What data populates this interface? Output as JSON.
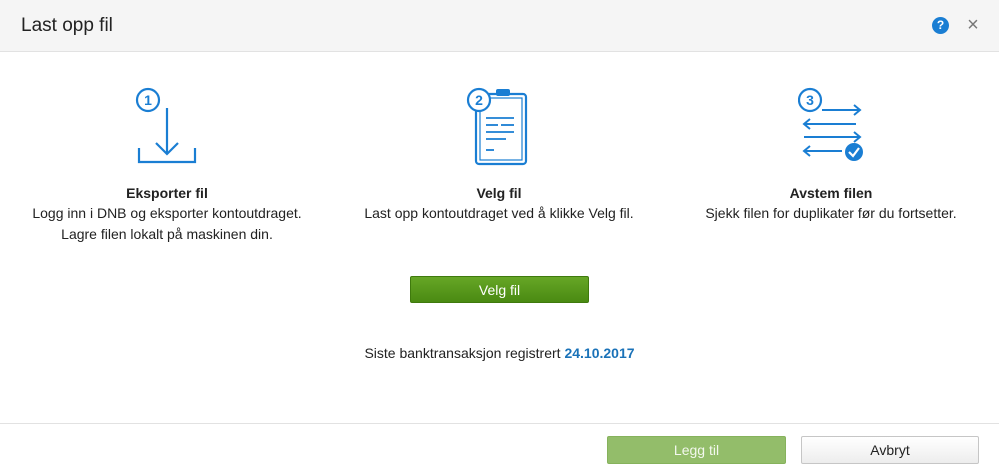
{
  "dialog": {
    "title": "Last opp fil",
    "help_symbol": "?",
    "close_symbol": "×"
  },
  "steps": [
    {
      "number": "1",
      "icon": "download-icon",
      "heading": "Eksporter fil",
      "description": "Logg inn i DNB og eksporter kontoutdraget. Lagre filen lokalt på maskinen din."
    },
    {
      "number": "2",
      "icon": "clipboard-document-icon",
      "heading": "Velg fil",
      "description": "Last opp kontoutdraget ved å klikke Velg fil."
    },
    {
      "number": "3",
      "icon": "reconcile-arrows-icon",
      "heading": "Avstem filen",
      "description": "Sjekk filen for duplikater før du fortsetter."
    }
  ],
  "select_file_button": "Velg fil",
  "last_transaction": {
    "label": "Siste banktransaksjon registrert",
    "date": "24.10.2017"
  },
  "footer": {
    "add_button": "Legg til",
    "cancel_button": "Avbryt"
  },
  "colors": {
    "accent_blue": "#1a7ed3",
    "primary_green": "#4a8a12",
    "disabled_green": "#93bd6a",
    "date_blue": "#1a72b8"
  }
}
